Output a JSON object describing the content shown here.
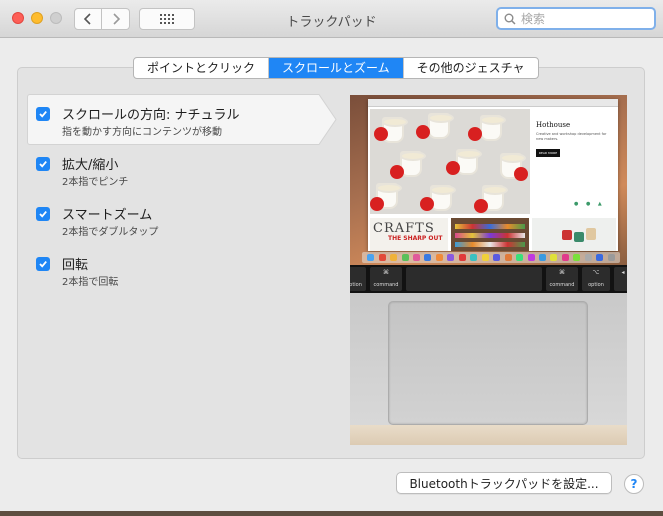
{
  "window": {
    "title": "トラックパッド"
  },
  "toolbar": {
    "back_icon": "chevron-left-icon",
    "forward_icon": "chevron-right-icon",
    "grid_icon": "grid-icon",
    "search_placeholder": "検索"
  },
  "tabs": [
    {
      "label": "ポイントとクリック",
      "active": false
    },
    {
      "label": "スクロールとズーム",
      "active": true
    },
    {
      "label": "その他のジェスチャ",
      "active": false
    }
  ],
  "options": [
    {
      "title": "スクロールの方向: ナチュラル",
      "subtitle": "指を動かす方向にコンテンツが移動",
      "checked": true,
      "selected": true
    },
    {
      "title": "拡大/縮小",
      "subtitle": "2本指でピンチ",
      "checked": true,
      "selected": false
    },
    {
      "title": "スマートズーム",
      "subtitle": "2本指でダブルタップ",
      "checked": true,
      "selected": false
    },
    {
      "title": "回転",
      "subtitle": "2本指で回転",
      "checked": true,
      "selected": false
    }
  ],
  "preview": {
    "site_title": "Hothouse",
    "site_body": "Creative and workshop development for new makers.",
    "read_more": "READ MORE",
    "tile_text": "CRAFTS",
    "tile_subtext": "THE SHARP OUT",
    "touchbar": {
      "left_label": "option",
      "left_cmd": "command",
      "right_cmd": "command",
      "right_label": "option",
      "cmd_symbol": "⌘",
      "opt_symbol": "⌥"
    }
  },
  "footer": {
    "bluetooth_button": "Bluetoothトラックパッドを設定...",
    "help_label": "?"
  },
  "colors": {
    "accent": "#1f86f5",
    "panel": "#e3e3e3",
    "window": "#ececec"
  }
}
